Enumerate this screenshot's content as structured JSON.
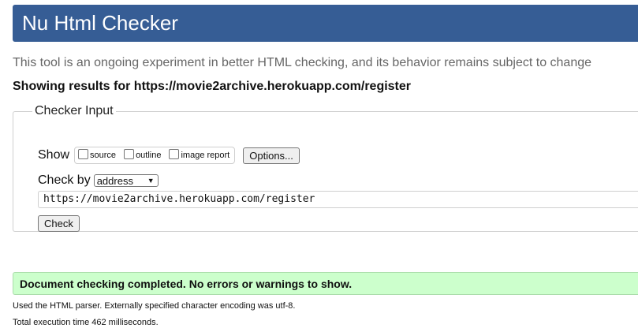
{
  "header": {
    "title": "Nu Html Checker"
  },
  "intro": "This tool is an ongoing experiment in better HTML checking, and its behavior remains subject to change",
  "showing": "Showing results for https://movie2archive.herokuapp.com/register",
  "checker_input": {
    "legend": "Checker Input",
    "show_label": "Show",
    "options": [
      {
        "label": "source",
        "checked": false
      },
      {
        "label": "outline",
        "checked": false
      },
      {
        "label": "image report",
        "checked": false
      }
    ],
    "options_button": "Options...",
    "check_by_label": "Check by",
    "check_by_value": "address",
    "url_value": "https://movie2archive.herokuapp.com/register",
    "check_button": "Check"
  },
  "result": {
    "message": "Document checking completed. No errors or warnings to show.",
    "success_color": "#ccffcc"
  },
  "notes": {
    "parser": "Used the HTML parser. Externally specified character encoding was utf-8.",
    "time": "Total execution time 462 milliseconds."
  },
  "colors": {
    "header_bg": "#365d95",
    "intro_text": "#666666"
  }
}
